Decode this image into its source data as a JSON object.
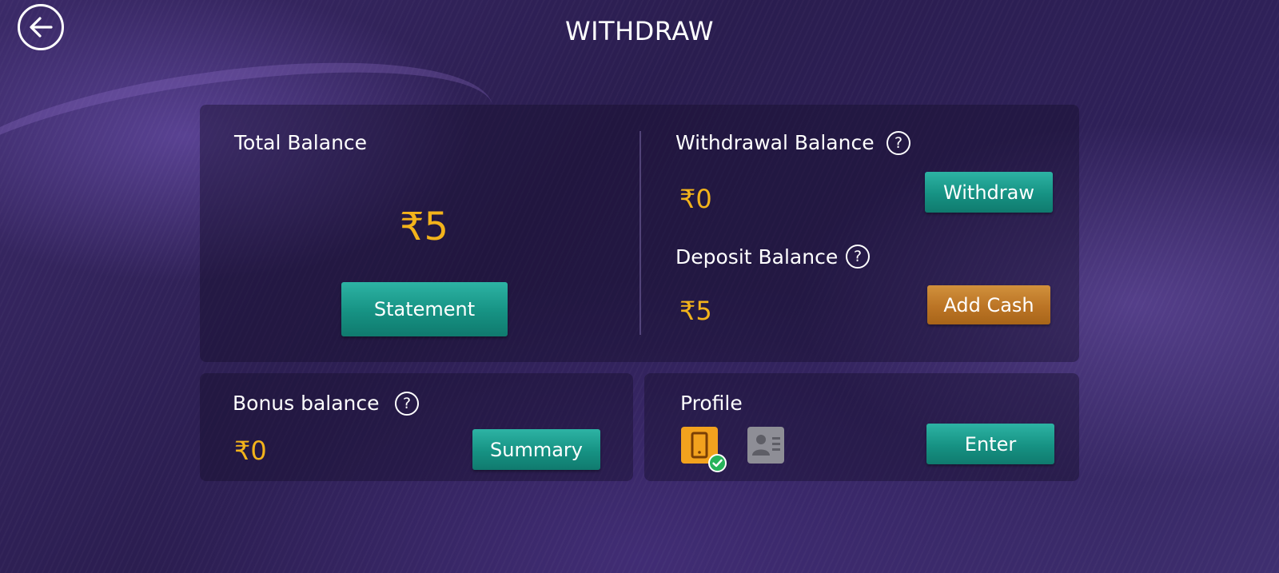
{
  "header": {
    "title": "WITHDRAW",
    "back_icon": "arrow-left-icon"
  },
  "total_balance": {
    "label": "Total Balance",
    "amount": "₹5",
    "statement_label": "Statement"
  },
  "withdrawal_balance": {
    "label": "Withdrawal Balance",
    "help": "?",
    "amount": "₹0",
    "withdraw_label": "Withdraw"
  },
  "deposit_balance": {
    "label": "Deposit Balance",
    "help": "?",
    "amount": "₹5",
    "add_cash_label": "Add Cash"
  },
  "bonus_balance": {
    "label": "Bonus balance",
    "help": "?",
    "amount": "₹0",
    "summary_label": "Summary"
  },
  "profile": {
    "label": "Profile",
    "enter_label": "Enter",
    "icons": [
      "phone-verified-icon",
      "id-card-icon"
    ]
  },
  "colors": {
    "amount": "#f3b31b",
    "teal_button": "#169283",
    "orange_button": "#bb7425",
    "verified": "#27b35a"
  }
}
